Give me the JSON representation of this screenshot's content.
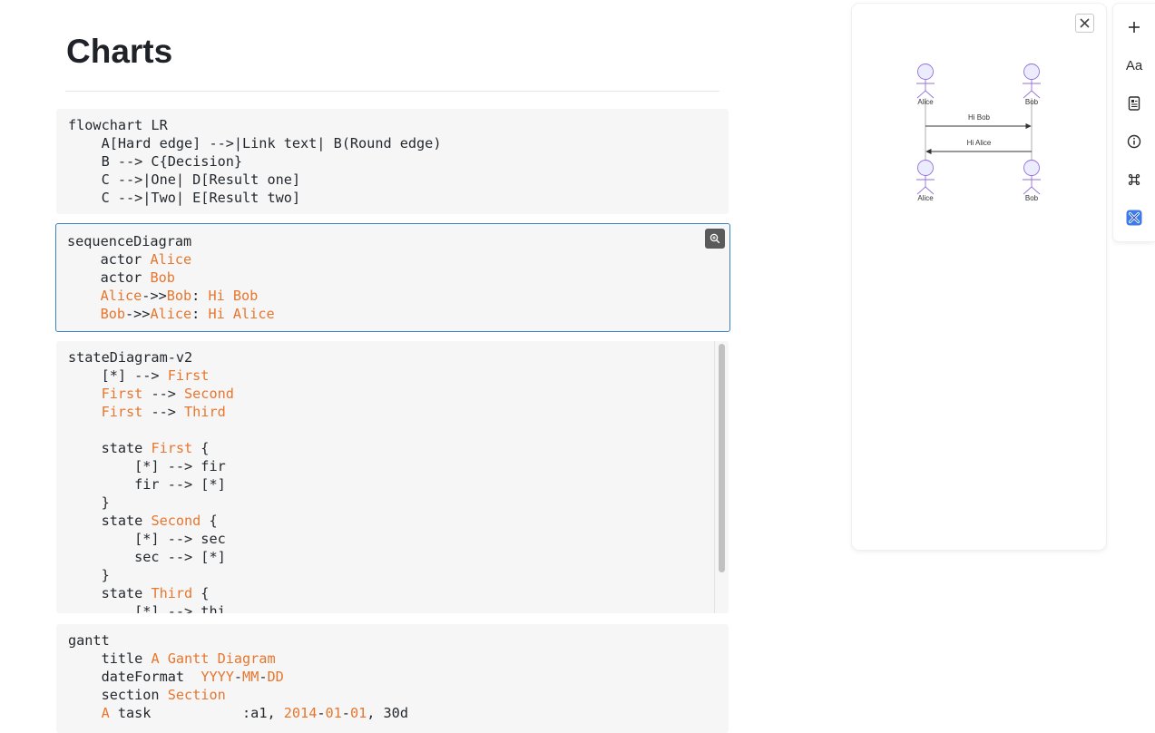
{
  "page": {
    "title": "Charts"
  },
  "blocks": [
    {
      "name": "flowchart-code",
      "lines": [
        [
          {
            "t": "flowchart LR"
          }
        ],
        [
          {
            "t": "    A[Hard edge] -->|Link text| B(Round edge)"
          }
        ],
        [
          {
            "t": "    B --> C{Decision}"
          }
        ],
        [
          {
            "t": "    C -->|One| D[Result one]"
          }
        ],
        [
          {
            "t": "    C -->|Two| E[Result two]"
          }
        ]
      ]
    },
    {
      "name": "sequence-diagram-code",
      "lines": [
        [
          {
            "t": "sequenceDiagram"
          }
        ],
        [
          {
            "t": "    actor "
          },
          {
            "t": "Alice",
            "h": 1
          }
        ],
        [
          {
            "t": "    actor "
          },
          {
            "t": "Bob",
            "h": 1
          }
        ],
        [
          {
            "t": "    "
          },
          {
            "t": "Alice",
            "h": 1
          },
          {
            "t": "->>"
          },
          {
            "t": "Bob",
            "h": 1
          },
          {
            "t": ": "
          },
          {
            "t": "Hi Bob",
            "h": 1
          }
        ],
        [
          {
            "t": "    "
          },
          {
            "t": "Bob",
            "h": 1
          },
          {
            "t": "->>"
          },
          {
            "t": "Alice",
            "h": 1
          },
          {
            "t": ": "
          },
          {
            "t": "Hi Alice",
            "h": 1
          }
        ]
      ]
    },
    {
      "name": "state-diagram-code",
      "lines": [
        [
          {
            "t": "stateDiagram-v2"
          }
        ],
        [
          {
            "t": "    [*] --> "
          },
          {
            "t": "First",
            "h": 1
          }
        ],
        [
          {
            "t": "    "
          },
          {
            "t": "First",
            "h": 1
          },
          {
            "t": " --> "
          },
          {
            "t": "Second",
            "h": 1
          }
        ],
        [
          {
            "t": "    "
          },
          {
            "t": "First",
            "h": 1
          },
          {
            "t": " --> "
          },
          {
            "t": "Third",
            "h": 1
          }
        ],
        [
          {
            "t": ""
          }
        ],
        [
          {
            "t": "    state "
          },
          {
            "t": "First",
            "h": 1
          },
          {
            "t": " {"
          }
        ],
        [
          {
            "t": "        [*] --> fir"
          }
        ],
        [
          {
            "t": "        fir --> [*]"
          }
        ],
        [
          {
            "t": "    }"
          }
        ],
        [
          {
            "t": "    state "
          },
          {
            "t": "Second",
            "h": 1
          },
          {
            "t": " {"
          }
        ],
        [
          {
            "t": "        [*] --> sec"
          }
        ],
        [
          {
            "t": "        sec --> [*]"
          }
        ],
        [
          {
            "t": "    }"
          }
        ],
        [
          {
            "t": "    state "
          },
          {
            "t": "Third",
            "h": 1
          },
          {
            "t": " {"
          }
        ],
        [
          {
            "t": "        [*] --> thi"
          }
        ]
      ]
    },
    {
      "name": "gantt-code",
      "lines": [
        [
          {
            "t": "gantt"
          }
        ],
        [
          {
            "t": "    title "
          },
          {
            "t": "A Gantt Diagram",
            "h": 1
          }
        ],
        [
          {
            "t": "    dateFormat  "
          },
          {
            "t": "YYYY",
            "h": 1
          },
          {
            "t": "-"
          },
          {
            "t": "MM",
            "h": 1
          },
          {
            "t": "-"
          },
          {
            "t": "DD",
            "h": 1
          }
        ],
        [
          {
            "t": "    section "
          },
          {
            "t": "Section",
            "h": 1
          }
        ],
        [
          {
            "t": "    "
          },
          {
            "t": "A",
            "h": 1
          },
          {
            "t": " task           :a1, "
          },
          {
            "t": "2014",
            "h": 1
          },
          {
            "t": "-"
          },
          {
            "t": "01",
            "h": 1
          },
          {
            "t": "-"
          },
          {
            "t": "01",
            "h": 1
          },
          {
            "t": ", 30d"
          }
        ]
      ]
    }
  ],
  "preview": {
    "actors": [
      "Alice",
      "Bob"
    ],
    "messages": [
      "Hi Bob",
      "Hi Alice"
    ]
  },
  "toolbar": {
    "font_label": "Aa"
  },
  "colors": {
    "highlight": "#e8762d",
    "active_border": "#3b82c4",
    "actor_fill": "#ececff",
    "actor_stroke": "#9370db"
  }
}
